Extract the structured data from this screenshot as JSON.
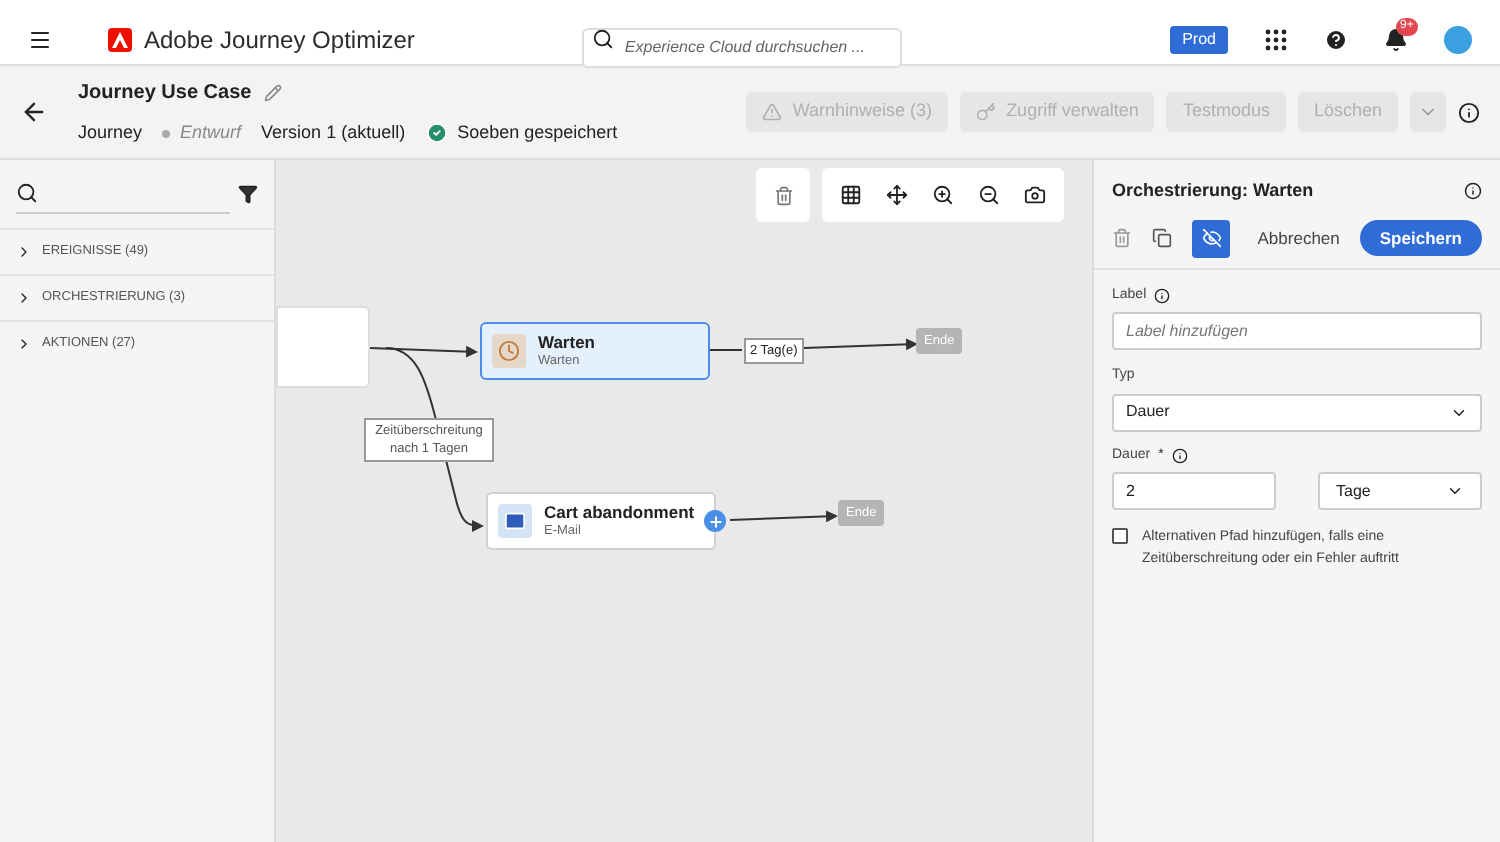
{
  "app": {
    "title": "Adobe Journey Optimizer",
    "search_placeholder": "Experience Cloud durchsuchen ...",
    "sandbox": "Prod",
    "notifications": "9+"
  },
  "journey": {
    "name": "Journey Use Case",
    "type": "Journey",
    "status": "Entwurf",
    "version": "Version 1 (aktuell)",
    "saved": "Soeben gespeichert"
  },
  "actions": [
    {
      "label": "Warnhinweise (3)",
      "disabled": true
    },
    {
      "label": "Zugriff verwalten",
      "disabled": true
    },
    {
      "label": "Testmodus",
      "disabled": true
    },
    {
      "label": "Löschen",
      "disabled": true
    }
  ],
  "sidebar": {
    "items": [
      {
        "label": "EREIGNISSE (49)",
        "expanded": false
      },
      {
        "label": "ORCHESTRIERUNG (3)",
        "expanded": false
      },
      {
        "label": "AKTIONEN (27)",
        "expanded": false
      }
    ]
  },
  "canvas": {
    "nodes": [
      {
        "kind": "wait",
        "title": "Warten",
        "subtitle": "Warten",
        "selected": true
      },
      {
        "kind": "email",
        "title": "Cart abandonment",
        "subtitle": "E-Mail",
        "selected": false
      }
    ],
    "edge_labels": [
      "2 Tag(e)",
      "Zeitüberschreitung nach 1 Tagen"
    ],
    "end_nodes": [
      "Ende",
      "Ende"
    ]
  },
  "panel": {
    "title": "Orchestrierung: Warten",
    "cancel": "Abbrechen",
    "save": "Speichern",
    "label_field": {
      "label": "Label",
      "placeholder": "Label hinzufügen"
    },
    "type_field": {
      "label": "Typ",
      "value": "Dauer"
    },
    "duration_field": {
      "label": "Dauer",
      "required_mark": "*",
      "value": "2",
      "unit": "Tage"
    },
    "alt_path": {
      "label": "Alternativen Pfad hinzufügen, falls eine Zeitüberschreitung oder ein Fehler auftritt",
      "checked": false
    }
  }
}
